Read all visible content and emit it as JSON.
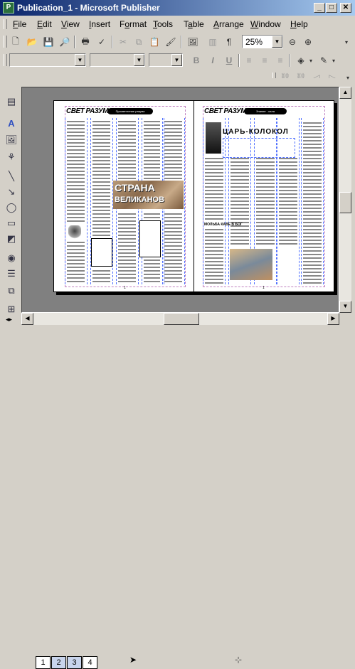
{
  "window": {
    "title": "Publication_1 - Microsoft Publisher",
    "app_icon": "publisher-icon"
  },
  "window_controls": {
    "minimize": "_",
    "maximize": "□",
    "close": "✕"
  },
  "menu": {
    "items": [
      {
        "label": "File",
        "accel": "F"
      },
      {
        "label": "Edit",
        "accel": "E"
      },
      {
        "label": "View",
        "accel": "V"
      },
      {
        "label": "Insert",
        "accel": "I"
      },
      {
        "label": "Format",
        "accel": "o"
      },
      {
        "label": "Tools",
        "accel": "T"
      },
      {
        "label": "Table",
        "accel": "a"
      },
      {
        "label": "Arrange",
        "accel": "A"
      },
      {
        "label": "Window",
        "accel": "W"
      },
      {
        "label": "Help",
        "accel": "H"
      }
    ]
  },
  "standard_toolbar": {
    "zoom_value": "25%",
    "buttons": [
      "new-icon",
      "open-icon",
      "save-icon",
      "search-folder-icon",
      "print-icon",
      "spelling-icon",
      "cut-icon",
      "copy-icon",
      "paste-icon",
      "format-painter-icon",
      "insert-picture-icon",
      "columns-icon",
      "pilcrow-icon",
      "zoom-out-icon",
      "zoom-in-icon"
    ]
  },
  "formatting_toolbar": {
    "style_value": "",
    "font_value": "",
    "size_value": "",
    "buttons": [
      "bold-icon",
      "italic-icon",
      "underline-icon",
      "align-left-icon",
      "align-center-icon",
      "align-right-icon",
      "justify-icon",
      "fill-color-icon",
      "line-color-icon"
    ],
    "labels": {
      "bold": "B",
      "italic": "I",
      "underline": "U"
    }
  },
  "connect_toolbar": {
    "buttons": [
      "link-text-icon",
      "unlink-text-icon",
      "previous-frame-icon",
      "next-frame-icon"
    ]
  },
  "objects_toolbar": {
    "buttons": [
      "select-objects-icon",
      "text-box-icon",
      "picture-frame-icon",
      "clip-art-icon",
      "line-tool-icon",
      "arrow-tool-icon",
      "oval-tool-icon",
      "rectangle-tool-icon",
      "autoshapes-icon",
      "hot-spot-icon",
      "form-control-icon",
      "design-gallery-icon",
      "more-objects-icon"
    ]
  },
  "publication": {
    "left_page": {
      "masthead": "СВЕТ РАЗУМА",
      "pill_text": "Просветление разума",
      "banner_line1": "СТРАНА",
      "banner_line2": "ВЕЛИКАНОВ",
      "page_number": "1"
    },
    "right_page": {
      "masthead": "СВЕТ РАЗУМА",
      "pill_text": "Знание - сила",
      "headline": "ЦАРЬ-КОЛОКОЛ",
      "subhead": "МОЛЬБА КАВЕ В БОГ",
      "page_number": "1"
    }
  },
  "page_sorter": {
    "pages": [
      "1",
      "2",
      "3",
      "4"
    ],
    "active_pages": [
      "2",
      "3"
    ]
  },
  "colors": {
    "title_gradient_start": "#0a246a",
    "title_gradient_end": "#a6caf0",
    "workspace": "#808080",
    "chrome": "#d4d0c8"
  }
}
